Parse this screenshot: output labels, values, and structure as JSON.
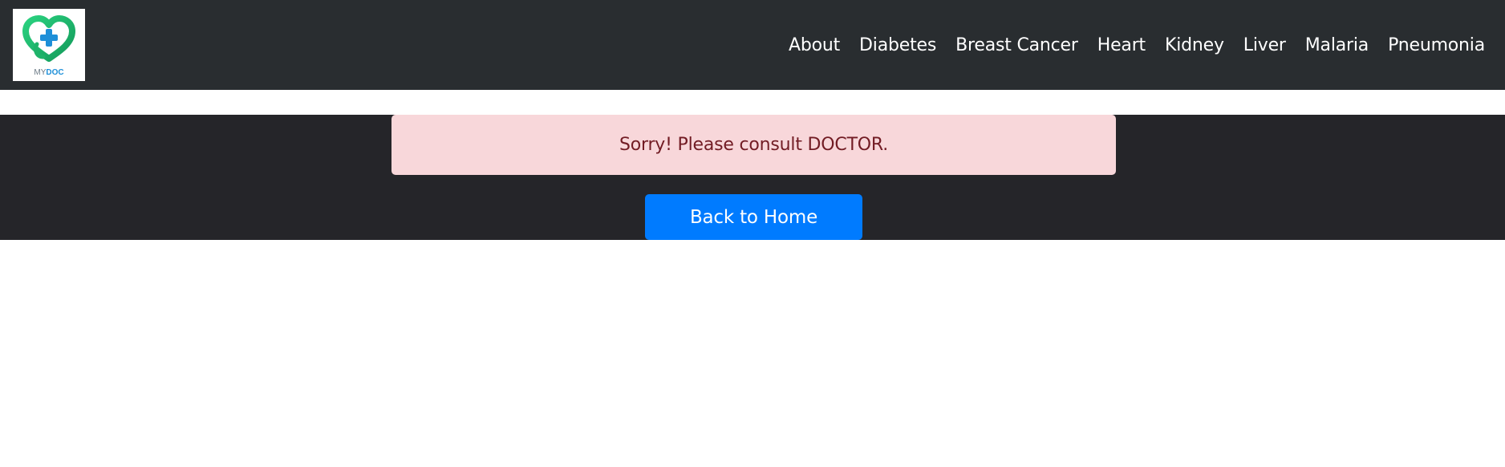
{
  "logo": {
    "text_my": "MY",
    "text_doc": "DOC",
    "colors": {
      "green": "#1fb36a",
      "blue": "#1d8fd8"
    }
  },
  "nav": {
    "links": [
      "About",
      "Diabetes",
      "Breast Cancer",
      "Heart",
      "Kidney",
      "Liver",
      "Malaria",
      "Pneumonia"
    ]
  },
  "alert": {
    "message": "Sorry! Please consult DOCTOR."
  },
  "home_button": {
    "label": "Back to Home"
  },
  "colors": {
    "navbar": "#292d30",
    "band": "#252529",
    "alert_bg": "#f8d7da",
    "alert_text": "#721c24",
    "button": "#007bff"
  }
}
